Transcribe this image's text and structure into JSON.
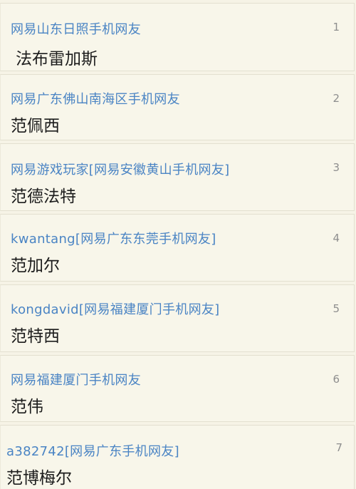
{
  "comments": [
    {
      "author": "网易山东日照手机网友",
      "floor": "1",
      "content": "法布雷加斯"
    },
    {
      "author": "网易广东佛山南海区手机网友",
      "floor": "2",
      "content": "范佩西"
    },
    {
      "author": "网易游戏玩家[网易安徽黄山手机网友]",
      "floor": "3",
      "content": "范德法特"
    },
    {
      "author": "kwantang[网易广东东莞手机网友]",
      "floor": "4",
      "content": "范加尔"
    },
    {
      "author": "kongdavid[网易福建厦门手机网友]",
      "floor": "5",
      "content": "范特西"
    },
    {
      "author": "网易福建厦门手机网友",
      "floor": "6",
      "content": "范伟"
    },
    {
      "author": "a382742[网易广东手机网友]",
      "floor": "7",
      "content": "范博梅尔"
    }
  ],
  "colors": {
    "author": "#4a84c4",
    "content": "#1c1c1c",
    "floor": "#8e8e8e",
    "background": "#f6f3e6"
  }
}
